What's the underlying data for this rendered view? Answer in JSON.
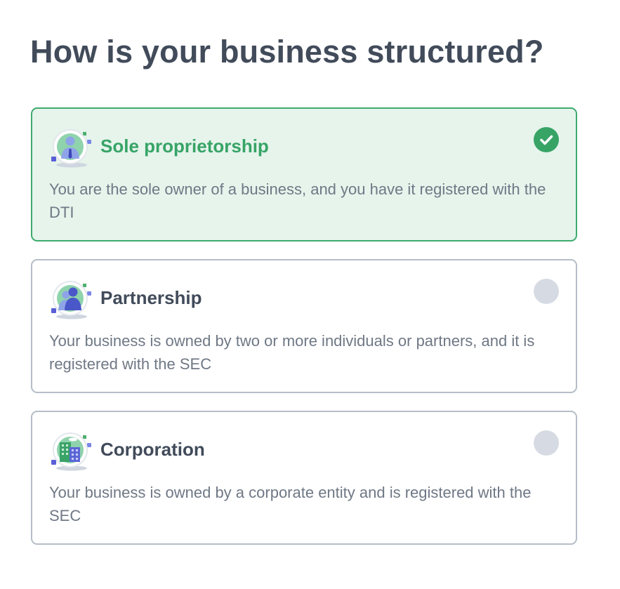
{
  "page": {
    "title": "How is your business structured?"
  },
  "options": [
    {
      "title": "Sole proprietorship",
      "description": "You are the sole owner of a business, and you have it registered with the DTI",
      "icon": "person-icon",
      "selected": true
    },
    {
      "title": "Partnership",
      "description": "Your business is owned by two or more individuals or partners, and it is registered with the SEC",
      "icon": "partners-icon",
      "selected": false
    },
    {
      "title": "Corporation",
      "description": "Your business is owned by a corporate entity and is registered with the SEC",
      "icon": "building-icon",
      "selected": false
    }
  ],
  "colors": {
    "accent": "#37a466",
    "selected_background": "#e6f4ec",
    "radio_unchecked": "#d6dbe3",
    "heading": "#414b5a",
    "body_text": "#6f7885"
  }
}
